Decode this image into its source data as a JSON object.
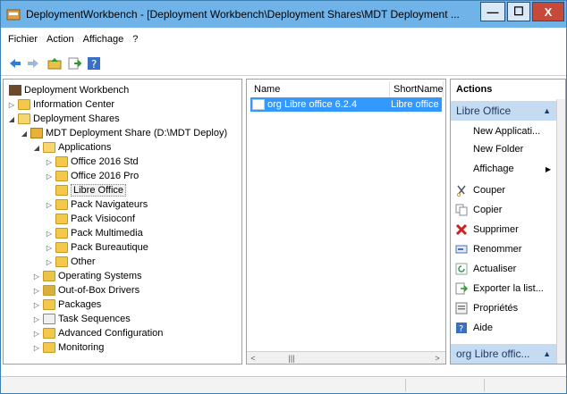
{
  "window": {
    "title": "DeploymentWorkbench - [Deployment Workbench\\Deployment Shares\\MDT Deployment ...",
    "title_bar_color": "#6fb3e8",
    "controls": {
      "minimize": "—",
      "maximize": "☐",
      "close": "X"
    }
  },
  "menu": [
    "Fichier",
    "Action",
    "Affichage",
    "?"
  ],
  "toolbar": {
    "icons": [
      "back-arrow-icon",
      "forward-arrow-icon",
      "up-folder-icon",
      "export-icon",
      "help-icon"
    ]
  },
  "tree": {
    "root": "Deployment Workbench",
    "information_center": "Information Center",
    "deployment_shares": "Deployment Shares",
    "mdt_share": "MDT Deployment Share (D:\\MDT Deploy)",
    "applications": "Applications",
    "app_children": [
      "Office 2016 Std",
      "Office 2016 Pro",
      "Libre Office",
      "Pack Navigateurs",
      "Pack Visioconf",
      "Pack Multimedia",
      "Pack Bureautique",
      "Other"
    ],
    "share_children": [
      "Operating Systems",
      "Out-of-Box Drivers",
      "Packages",
      "Task Sequences",
      "Advanced Configuration",
      "Monitoring"
    ]
  },
  "list": {
    "columns": [
      "Name",
      "ShortName"
    ],
    "rows": [
      {
        "name": "org Libre office 6.2.4",
        "short_name": "Libre office"
      }
    ],
    "selection_color": "#3399ff"
  },
  "actions": {
    "header": "Actions",
    "section1": "Libre Office",
    "section1_items": [
      "New Applicati...",
      "New Folder",
      "Affichage",
      "Couper",
      "Copier",
      "Supprimer",
      "Renommer",
      "Actualiser",
      "Exporter la list...",
      "Propriétés",
      "Aide"
    ],
    "section2": "org Libre offic...",
    "section_color": "#c4dbf2"
  }
}
